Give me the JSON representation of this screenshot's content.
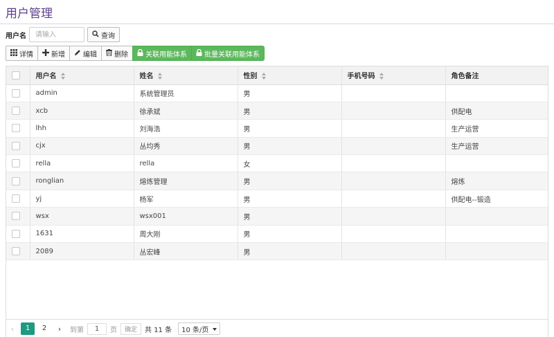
{
  "page": {
    "title": "用户管理"
  },
  "search": {
    "label": "用户名",
    "placeholder": "请输入",
    "query_label": "查询"
  },
  "toolbar": {
    "detail": "详情",
    "add": "新增",
    "edit": "编辑",
    "delete": "删除",
    "link_system": "关联用能体系",
    "batch_link_system": "批量关联用能体系"
  },
  "table": {
    "columns": [
      "用户名",
      "姓名",
      "性别",
      "手机号码",
      "角色备注"
    ],
    "rows": [
      [
        "admin",
        "系统管理员",
        "男",
        "",
        ""
      ],
      [
        "xcb",
        "徐承斌",
        "男",
        "",
        "供配电"
      ],
      [
        "lhh",
        "刘海浩",
        "男",
        "",
        "生产运营"
      ],
      [
        "cjx",
        "丛均秀",
        "男",
        "",
        "生产运营"
      ],
      [
        "rella",
        "rella",
        "女",
        "",
        ""
      ],
      [
        "ronglian",
        "熔炼管理",
        "男",
        "",
        "熔炼"
      ],
      [
        "yj",
        "杨军",
        "男",
        "",
        "供配电--锻造"
      ],
      [
        "wsx",
        "wsx001",
        "男",
        "",
        ""
      ],
      [
        "1631",
        "周大刚",
        "男",
        "",
        ""
      ],
      [
        "2089",
        "丛宏峰",
        "男",
        "",
        ""
      ]
    ]
  },
  "pager": {
    "pages": [
      "1",
      "2"
    ],
    "goto_label": "到第",
    "page_value": "1",
    "page_unit": "页",
    "confirm": "确定",
    "total": "共 11 条",
    "page_size": "10 条/页"
  },
  "colors": {
    "title": "#5b3f8c",
    "green": "#5cb85c",
    "pager_active": "#1e9a80"
  }
}
